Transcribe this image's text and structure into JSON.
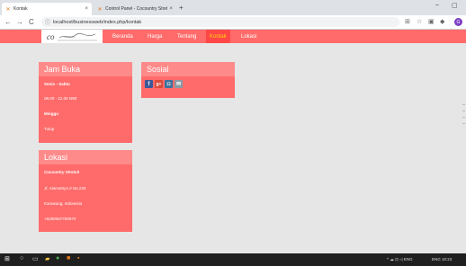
{
  "browser": {
    "tabs": [
      {
        "title": "Kontak",
        "close": "×"
      },
      {
        "title": "Control Panel - Cocountry Stretc",
        "close": "×"
      }
    ],
    "new_tab": "+",
    "window_controls": {
      "minimize": "–",
      "restore": "▢"
    },
    "nav": {
      "back": "←",
      "forward": "→",
      "reload": "C"
    },
    "url": "localhost/businessweb/index.php/kontak",
    "url_info_icon": "info-icon",
    "extensions": [
      "translate-icon",
      "star-icon",
      "extension-icon",
      "puzzle-icon"
    ],
    "profile_initial": "G"
  },
  "site": {
    "logo_text": "cocountry",
    "nav_items": [
      "Beranda",
      "Harga",
      "Tentang",
      "Kontak",
      "Lokasi"
    ],
    "active_nav": "Kontak",
    "colors": {
      "primary": "#ff6b6b",
      "header": "#ff8a8a",
      "active": "#ffd60a"
    }
  },
  "jam_buka": {
    "title": "Jam Buka",
    "days_label": "Senin - Sabtu",
    "hours": "08.00 - 21.00 WIB",
    "sunday_label": "Minggu",
    "sunday_status": "Tutup"
  },
  "sosial": {
    "title": "Sosial",
    "icons": [
      {
        "name": "facebook-icon",
        "glyph": "f",
        "color": "#3b5998"
      },
      {
        "name": "google-plus-icon",
        "glyph": "g+",
        "color": "#dd4b39"
      },
      {
        "name": "instagram-icon",
        "glyph": "◘",
        "color": "#3f729b"
      },
      {
        "name": "email-icon",
        "glyph": "✉",
        "color": "#8a9aa5"
      }
    ]
  },
  "lokasi": {
    "title": "Lokasi",
    "name": "Cocountry Stretch",
    "address": "Jl. Alamatnya II No.234",
    "city": "Karawang, Indonesia",
    "phone": "+6289567765973"
  },
  "taskbar": {
    "clock": "ENG 10:23",
    "tray_icons": "^ ☁ ⊡ ◁ ENG"
  }
}
